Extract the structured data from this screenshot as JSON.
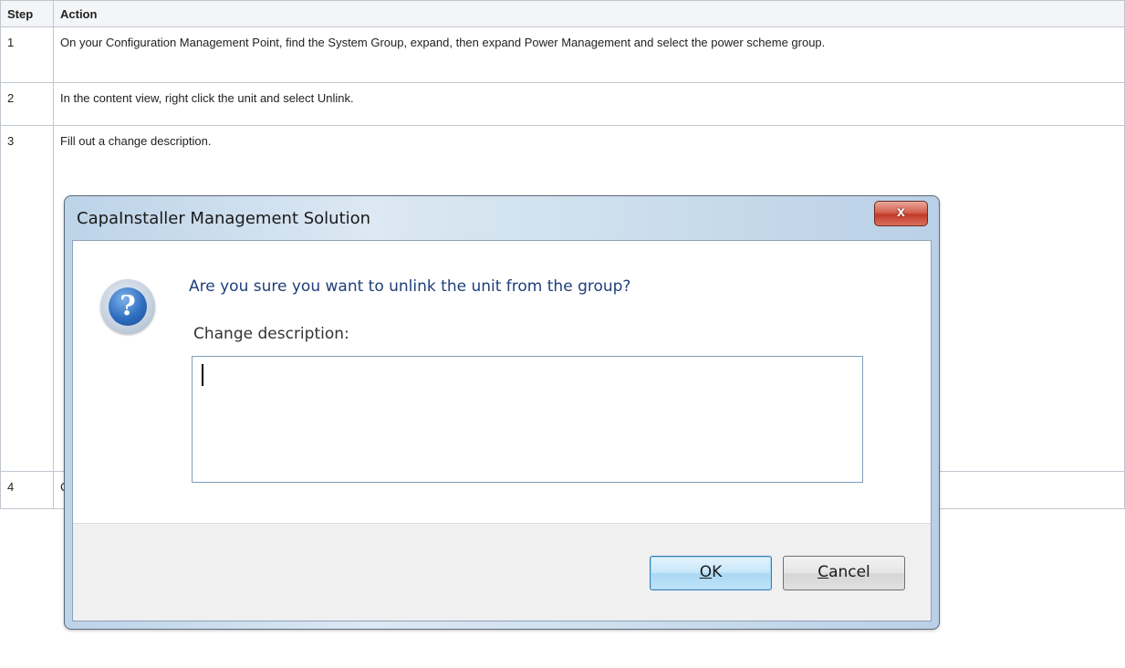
{
  "table": {
    "headers": [
      "Step",
      "Action"
    ],
    "rows": [
      {
        "step": "1",
        "action": "On your Configuration Management Point, find the System Group, expand, then expand Power Management and select the power scheme group."
      },
      {
        "step": "2",
        "action": "In the content view, right click the unit and select Unlink."
      },
      {
        "step": "3",
        "action": "Fill out a change description."
      },
      {
        "step": "4",
        "action": "Click OK."
      }
    ]
  },
  "dialog": {
    "title": "CapaInstaller Management Solution",
    "close_label": "x",
    "prompt": "Are you sure you want to unlink the unit from the group?",
    "change_label": "Change description:",
    "input_value": "",
    "ok_accel": "O",
    "ok_rest": "K",
    "cancel_accel": "C",
    "cancel_rest": "ancel",
    "icon": "question-icon",
    "icon_glyph": "?"
  }
}
